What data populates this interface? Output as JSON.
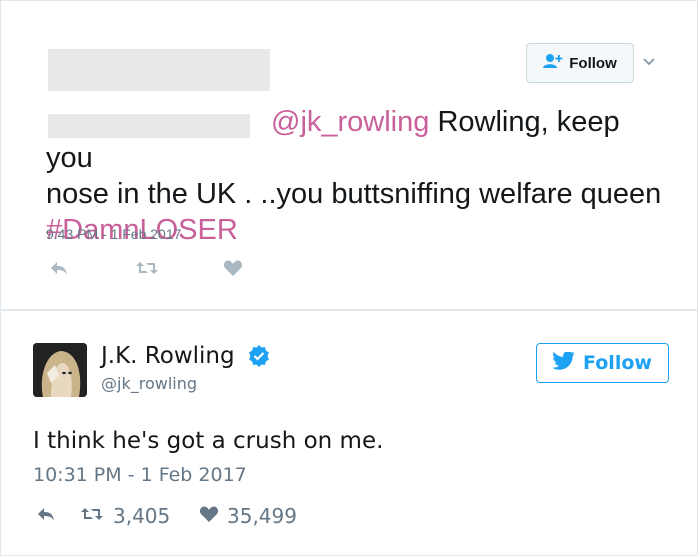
{
  "tweet1": {
    "follow_label": "Follow",
    "mention": "@jk_rowling",
    "text_line1": " Rowling, keep you",
    "text_line2": "nose in the UK . ..you buttsniffing welfare queen",
    "hashtag": "#DamnLOSER",
    "timestamp": "9:43 PM - 1 Feb 2017",
    "icons": [
      "reply-icon",
      "retweet-icon",
      "like-icon"
    ]
  },
  "tweet2": {
    "name": "J.K. Rowling",
    "handle": "@jk_rowling",
    "follow_label": "Follow",
    "text": "I think he's got a crush on me.",
    "timestamp": "10:31 PM - 1 Feb 2017",
    "retweets": "3,405",
    "likes": "35,499"
  },
  "colors": {
    "accent": "#1da1f2",
    "hashtag": "#c9609a",
    "muted": "#657786",
    "verified": "#1da1f2"
  }
}
